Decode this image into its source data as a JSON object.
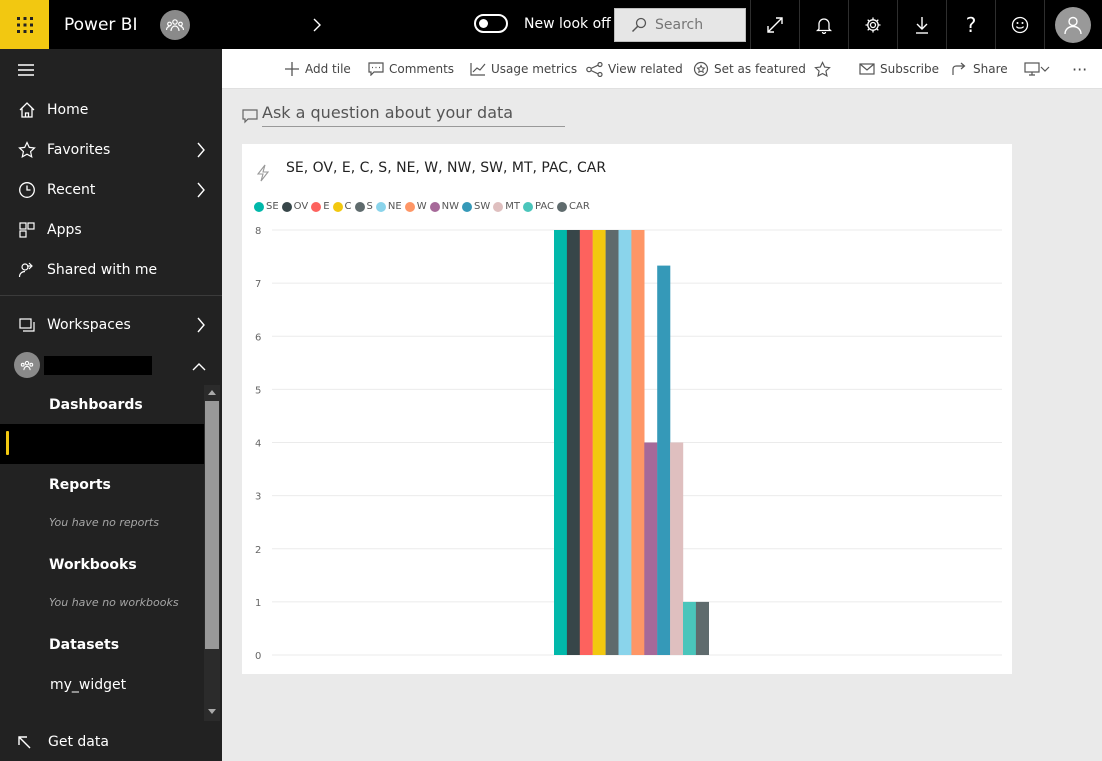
{
  "app": {
    "title": "Power BI",
    "toggle_label": "New look off",
    "search_placeholder": "Search"
  },
  "nav": {
    "items": [
      {
        "label": "Home",
        "icon": "home-icon"
      },
      {
        "label": "Favorites",
        "icon": "star-icon"
      },
      {
        "label": "Recent",
        "icon": "clock-icon"
      },
      {
        "label": "Apps",
        "icon": "apps-icon"
      },
      {
        "label": "Shared with me",
        "icon": "shared-icon"
      }
    ],
    "workspaces": "Workspaces",
    "sections": {
      "dashboards": "Dashboards",
      "reports": "Reports",
      "reports_empty": "You have no reports",
      "workbooks": "Workbooks",
      "workbooks_empty": "You have no workbooks",
      "datasets": "Datasets",
      "dataset_item": "my_widget"
    },
    "get_data": "Get data"
  },
  "actions": {
    "add_tile": "Add tile",
    "comments": "Comments",
    "usage_metrics": "Usage metrics",
    "view_related": "View related",
    "set_featured": "Set as featured",
    "subscribe": "Subscribe",
    "share": "Share"
  },
  "qna": {
    "placeholder": "Ask a question about your data"
  },
  "tile": {
    "title": "SE, OV, E, C, S, NE, W, NW, SW, MT, PAC, CAR"
  },
  "chart_data": {
    "type": "bar",
    "categories": [
      "SE",
      "OV",
      "E",
      "C",
      "S",
      "NE",
      "W",
      "NW",
      "SW",
      "MT",
      "PAC",
      "CAR"
    ],
    "values": [
      8,
      8,
      8,
      8,
      8,
      8,
      8,
      4,
      7.33,
      4,
      1,
      1
    ],
    "colors": [
      "#01b8aa",
      "#374649",
      "#fd625e",
      "#f2c80f",
      "#5f6b6d",
      "#8ad4eb",
      "#fe9666",
      "#a66999",
      "#3599b8",
      "#dfbfbf",
      "#4ac5bb",
      "#5f6b6d"
    ],
    "title": "SE, OV, E, C, S, NE, W, NW, SW, MT, PAC, CAR",
    "ylim": [
      0,
      8
    ],
    "yticks": [
      0,
      1,
      2,
      3,
      4,
      5,
      6,
      7,
      8
    ],
    "grid": true,
    "legend": "top-left"
  }
}
